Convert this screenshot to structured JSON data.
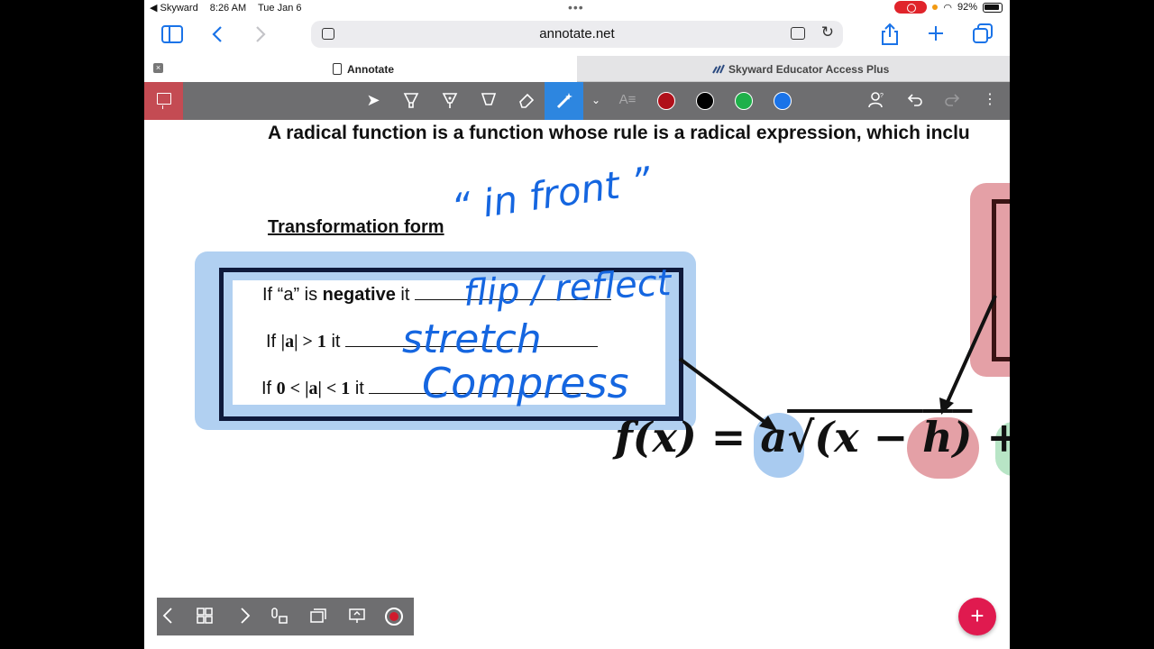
{
  "status_bar": {
    "back_app": "◀ Skyward",
    "time": "8:26 AM",
    "date": "Tue Jan 6",
    "battery": "92%"
  },
  "browser": {
    "url": "annotate.net",
    "tabs": [
      {
        "label": "Annotate",
        "active": true
      },
      {
        "label": "Skyward Educator Access Plus",
        "active": false
      }
    ]
  },
  "annotate_toolbar": {
    "pen_colors": [
      "#b0101a",
      "#000000",
      "#1fb04a",
      "#1a73e8"
    ],
    "tools": [
      "select-icon",
      "highlighter-icon",
      "pen-icon",
      "marker-icon",
      "eraser-icon",
      "magic-pen-icon",
      "text-icon"
    ],
    "text_tool_label": "A≡"
  },
  "page": {
    "heading": "A radical function is a function whose rule is a radical expression, which inclu",
    "transformation_label": "Transformation form",
    "rules": [
      {
        "prefix": "If “a” is ",
        "bold": "negative",
        "suffix": " it"
      },
      {
        "prefix": "If ",
        "bold": "|a| > 1",
        "suffix": " it"
      },
      {
        "prefix": "If ",
        "bold": "0 < |a| < 1",
        "suffix": " it"
      }
    ],
    "formula_parts": {
      "fx": "f(x) = ",
      "a": "a",
      "radical": "√(x − ",
      "h": "h",
      "close": ")",
      "plus": " +"
    }
  },
  "handwriting": {
    "in_front": "“ in front ”",
    "answer_1": "flip / reflect",
    "answer_2": "stretch",
    "answer_3": "Compress"
  }
}
